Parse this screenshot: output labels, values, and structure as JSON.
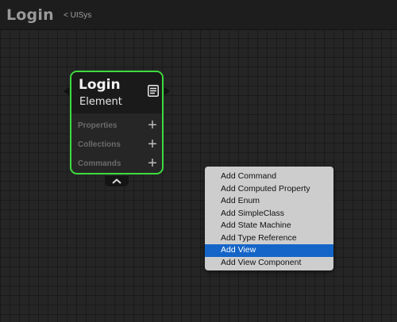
{
  "header": {
    "title": "Login",
    "back_label": "< UISys"
  },
  "node": {
    "name": "Login",
    "type": "Element",
    "border_color": "#3ddc3d",
    "doc_icon": "document-icon",
    "sections": [
      {
        "label": "Properties",
        "add": "+"
      },
      {
        "label": "Collections",
        "add": "+"
      },
      {
        "label": "Commands",
        "add": "+"
      }
    ]
  },
  "context_menu": {
    "items": [
      {
        "label": "Add Command"
      },
      {
        "label": "Add Computed Property"
      },
      {
        "label": "Add Enum"
      },
      {
        "label": "Add SimpleClass"
      },
      {
        "label": "Add State Machine"
      },
      {
        "label": "Add Type Reference"
      },
      {
        "label": "Add View",
        "selected": true
      },
      {
        "label": "Add View Component"
      }
    ],
    "highlight_color": "#1565c8"
  }
}
